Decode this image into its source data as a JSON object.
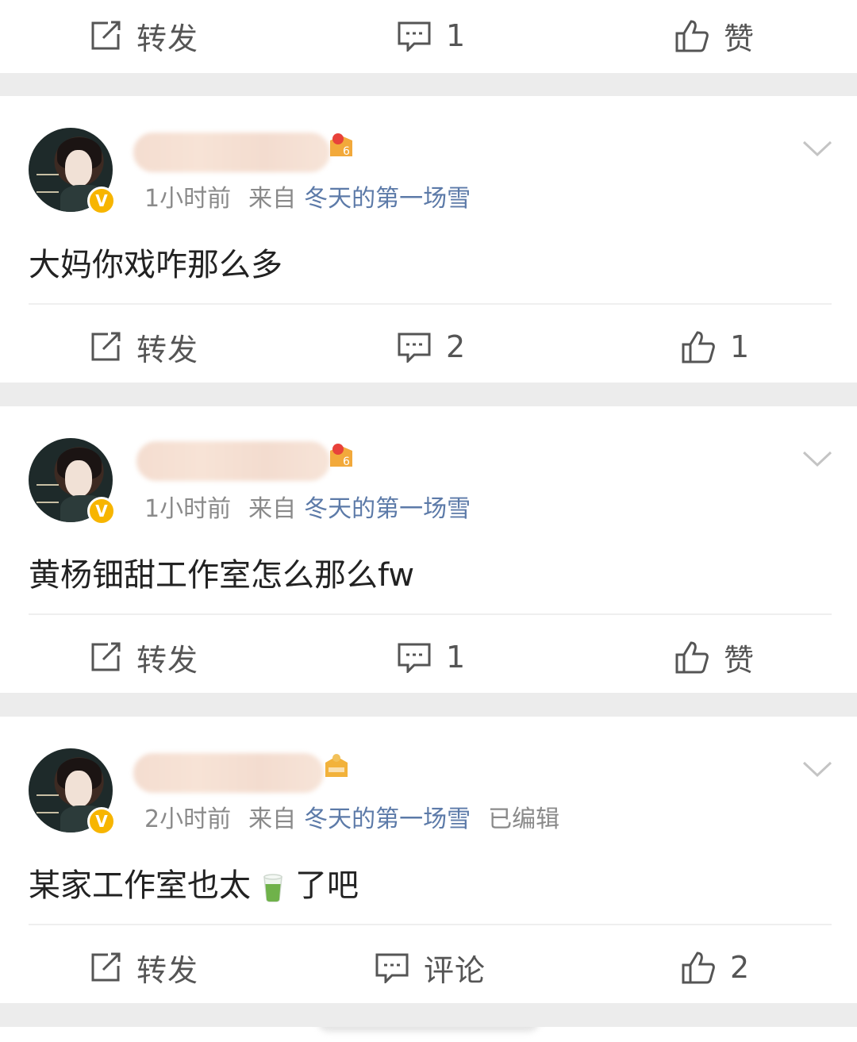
{
  "top_bar": {
    "repost": "转发",
    "comment": "1",
    "like": "赞"
  },
  "posts": [
    {
      "time": "1小时前",
      "from": "来自",
      "source": "冬天的第一场雪",
      "edited": "",
      "content": "大妈你戏咋那么多",
      "repost": "转发",
      "comment": "2",
      "like": "1"
    },
    {
      "time": "1小时前",
      "from": "来自",
      "source": "冬天的第一场雪",
      "edited": "",
      "content": "黄杨钿甜工作室怎么那么fw",
      "repost": "转发",
      "comment": "1",
      "like": "赞"
    },
    {
      "time": "2小时前",
      "from": "来自",
      "source": "冬天的第一场雪",
      "edited": "已编辑",
      "content_before": "某家工作室也太",
      "content_after": "了吧",
      "repost": "转发",
      "comment": "评论",
      "like": "2"
    }
  ],
  "icons": {
    "repost": "repost-icon",
    "comment": "comment-icon",
    "like": "thumbs-up-icon",
    "more": "chevron-down-icon",
    "verified": "verified-badge-icon",
    "emoji": "tea-emoji"
  },
  "colors": {
    "source_link": "#5c7aa8",
    "meta_gray": "#8a8a8a",
    "verified": "#f7b500",
    "background": "#ececec"
  }
}
